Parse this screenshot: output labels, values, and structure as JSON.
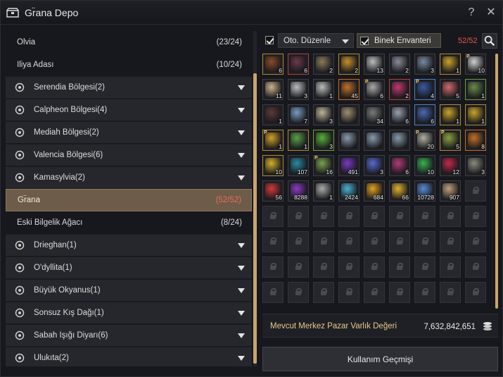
{
  "window": {
    "title": "Gr̈ana Depo",
    "help_label": "?",
    "close_label": "✕"
  },
  "left_list": [
    {
      "kind": "plain",
      "label": "Olvia",
      "count": "(23/24)"
    },
    {
      "kind": "plain",
      "label": "Iliya Adası",
      "count": "(10/24)"
    },
    {
      "kind": "region",
      "label": "Serendia Bölgesi(2)",
      "icon": "serendia-emblem-icon"
    },
    {
      "kind": "region",
      "label": "Calpheon Bölgesi(4)",
      "icon": "calpheon-emblem-icon"
    },
    {
      "kind": "region",
      "label": "Mediah Bölgesi(2)",
      "icon": "mediah-emblem-icon"
    },
    {
      "kind": "region",
      "label": "Valencia Bölgesi(6)",
      "icon": "valencia-emblem-icon"
    },
    {
      "kind": "region",
      "label": "Kamasylvia(2)",
      "icon": "kamasylvia-emblem-icon"
    },
    {
      "kind": "selected",
      "label": "Gr̈ana",
      "count": "(52/52)"
    },
    {
      "kind": "plain",
      "label": "Eski Bilgelik Ağacı",
      "count": "(8/24)"
    },
    {
      "kind": "region",
      "label": "Drieghan(1)",
      "icon": "drieghan-emblem-icon"
    },
    {
      "kind": "region",
      "label": "O'dyllita(1)",
      "icon": "odyllita-emblem-icon"
    },
    {
      "kind": "region",
      "label": "Büyük Okyanus(1)",
      "icon": "ocean-emblem-icon"
    },
    {
      "kind": "region",
      "label": "Sonsuz Kış Dağı(1)",
      "icon": "winter-mountain-emblem-icon"
    },
    {
      "kind": "region",
      "label": "Sabah Işığı Diyarı(6)",
      "icon": "morning-light-emblem-icon"
    },
    {
      "kind": "region",
      "label": "Ulukıta(2)",
      "icon": "ulukita-emblem-icon"
    }
  ],
  "toolbar": {
    "auto_sort_label": "Oto. Düzenle",
    "mount_inventory_label": "Binek Envanteri",
    "slot_count": "52/52"
  },
  "items": [
    {
      "q": "6",
      "c": "#8a4a2a",
      "b": "gold"
    },
    {
      "q": "6",
      "c": "#6a3a4a",
      "b": "red"
    },
    {
      "q": "2",
      "c": "#8a7a5a",
      "b": ""
    },
    {
      "q": "2",
      "c": "#c4902a",
      "b": "gold"
    },
    {
      "q": "13",
      "c": "#bdbdbd",
      "b": ""
    },
    {
      "q": "2",
      "c": "#8a8a9a",
      "b": ""
    },
    {
      "q": "3",
      "c": "#7a8aa0",
      "b": ""
    },
    {
      "q": "1",
      "c": "#c9a22a",
      "b": "gold"
    },
    {
      "q": "10",
      "c": "#d0d0d0",
      "b": "",
      "p": true
    },
    {
      "q": "11",
      "c": "#c9b48a",
      "b": ""
    },
    {
      "q": "3",
      "c": "#bdbdbd",
      "b": ""
    },
    {
      "q": "1",
      "c": "#bdbdbd",
      "b": ""
    },
    {
      "q": "45",
      "c": "#c0702a",
      "b": "orange"
    },
    {
      "q": "6",
      "c": "#aaaaaa",
      "b": "",
      "p": true
    },
    {
      "q": "2",
      "c": "#c03a6a",
      "b": "red"
    },
    {
      "q": "4",
      "c": "#3a5aa0",
      "b": "blue",
      "p": true
    },
    {
      "q": "5",
      "c": "#d06a6a",
      "b": ""
    },
    {
      "q": "1",
      "c": "#6a8a4a",
      "b": "green"
    },
    {
      "q": "1",
      "c": "#5a3a3a",
      "b": ""
    },
    {
      "q": "7",
      "c": "#7a9ac0",
      "b": ""
    },
    {
      "q": "3",
      "c": "#c0b49a",
      "b": ""
    },
    {
      "q": "",
      "c": "#a09070",
      "b": ""
    },
    {
      "q": "34",
      "c": "#7a7a7a",
      "b": ""
    },
    {
      "q": "6",
      "c": "#9aa0b0",
      "b": ""
    },
    {
      "q": "6",
      "c": "#4a6ab0",
      "b": "blue"
    },
    {
      "q": "1",
      "c": "#c9a22a",
      "b": "gold"
    },
    {
      "q": "1",
      "c": "#c9a22a",
      "b": "gold"
    },
    {
      "q": "1",
      "c": "#d0a02a",
      "b": "gold",
      "p": true
    },
    {
      "q": "1",
      "c": "#5aa04a",
      "b": "gold"
    },
    {
      "q": "3",
      "c": "#5ab03a",
      "b": "green"
    },
    {
      "q": "",
      "c": "#8a9aaa",
      "b": ""
    },
    {
      "q": "",
      "c": "#8a9aaa",
      "b": ""
    },
    {
      "q": "",
      "c": "#8a9aaa",
      "b": ""
    },
    {
      "q": "20",
      "c": "#b0b0a0",
      "b": "",
      "p": true
    },
    {
      "q": "5",
      "c": "#8aa040",
      "b": "gold",
      "p": true
    },
    {
      "q": "8",
      "c": "#c0702a",
      "b": "orange"
    },
    {
      "q": "10",
      "c": "#d0b02a",
      "b": "gold"
    },
    {
      "q": "107",
      "c": "#2a8aa0",
      "b": ""
    },
    {
      "q": "16",
      "c": "#7aa050",
      "b": "",
      "p": true
    },
    {
      "q": "491",
      "c": "#7a3ac0",
      "b": ""
    },
    {
      "q": "3",
      "c": "#5a6ad0",
      "b": ""
    },
    {
      "q": "6",
      "c": "#b03a7a",
      "b": ""
    },
    {
      "q": "10",
      "c": "#3ab050",
      "b": ""
    },
    {
      "q": "12",
      "c": "#c02a4a",
      "b": ""
    },
    {
      "q": "3",
      "c": "#8a8a7a",
      "b": ""
    },
    {
      "q": "56",
      "c": "#d03a3a",
      "b": ""
    },
    {
      "q": "8288",
      "c": "#8a3ac0",
      "b": ""
    },
    {
      "q": "1",
      "c": "#aaaaaa",
      "b": ""
    },
    {
      "q": "2424",
      "c": "#4ab0d0",
      "b": ""
    },
    {
      "q": "684",
      "c": "#e0a020",
      "b": ""
    },
    {
      "q": "66",
      "c": "#e0b030",
      "b": ""
    },
    {
      "q": "10728",
      "c": "#5a8ad0",
      "b": ""
    },
    {
      "q": "907",
      "c": "#c0a080",
      "b": ""
    }
  ],
  "market": {
    "label": "Mevcut Merkez Pazar Varlık Değeri",
    "value": "7,632,842,651"
  },
  "history_button_label": "Kullanım Geçmişi",
  "colors": {
    "accent_gold": "#c9a46e",
    "selected_row": "#6d5c49",
    "count_red": "#e0584a"
  }
}
